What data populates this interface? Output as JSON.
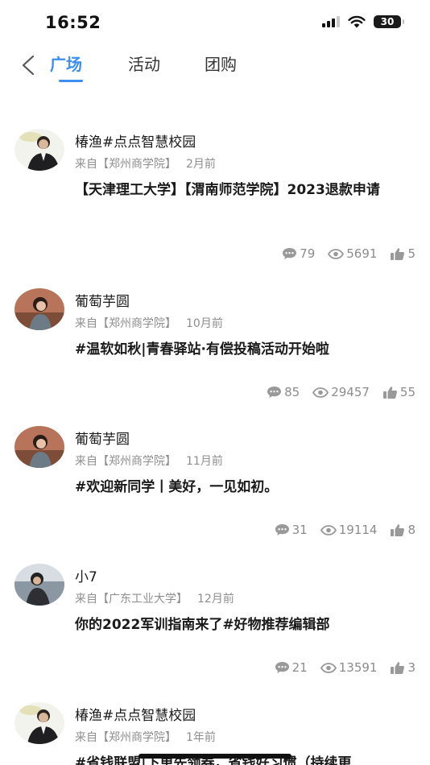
{
  "status_bar": {
    "time": "16:52",
    "battery": "30"
  },
  "nav": {
    "tabs": [
      {
        "label": "广场",
        "active": true
      },
      {
        "label": "活动",
        "active": false
      },
      {
        "label": "团购",
        "active": false
      }
    ],
    "accent_color": "#3d8ef0"
  },
  "posts": [
    {
      "author": "椿渔#点点智慧校园",
      "source": "来自【郑州商学院】",
      "time": "2月前",
      "title": "【天津理工大学】【渭南师范学院】2023退款申请",
      "comments": "79",
      "views": "5691",
      "likes": "5"
    },
    {
      "author": "葡萄芋圆",
      "source": "来自【郑州商学院】",
      "time": "10月前",
      "title": "#温软如秋|青春驿站·有偿投稿活动开始啦",
      "comments": "85",
      "views": "29457",
      "likes": "55"
    },
    {
      "author": "葡萄芋圆",
      "source": "来自【郑州商学院】",
      "time": "11月前",
      "title": "#欢迎新同学丨美好，一见如初。",
      "comments": "31",
      "views": "19114",
      "likes": "8"
    },
    {
      "author": "小7",
      "source": "来自【广东工业大学】",
      "time": "12月前",
      "title": "你的2022军训指南来了#好物推荐编辑部",
      "comments": "21",
      "views": "13591",
      "likes": "3"
    },
    {
      "author": "椿渔#点点智慧校园",
      "source": "来自【郑州商学院】",
      "time": "1年前",
      "title": "#省钱联盟|下单先领券，省钱好习惯（持续更"
    }
  ]
}
